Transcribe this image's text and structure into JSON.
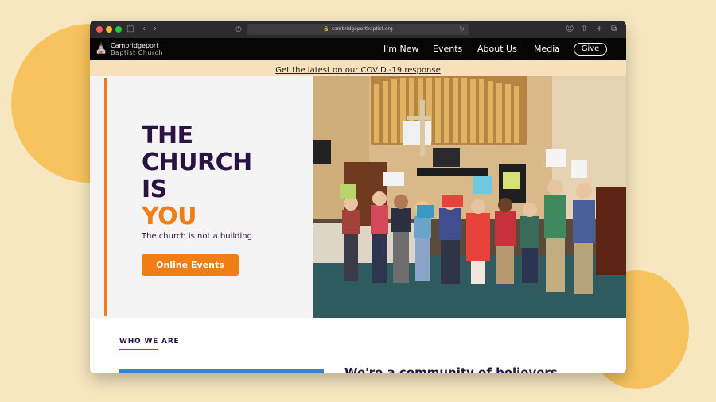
{
  "browser": {
    "url": "cambridgeportbaptist.org",
    "traffic_lights": [
      "#ff5f57",
      "#febc2e",
      "#28c840"
    ]
  },
  "site": {
    "logo_line1": "Cambridgeport",
    "logo_line2": "Baptist Church"
  },
  "nav": {
    "items": [
      {
        "label": "I'm New"
      },
      {
        "label": "Events"
      },
      {
        "label": "About Us"
      },
      {
        "label": "Media"
      }
    ],
    "give_label": "Give"
  },
  "banner": {
    "text": "Get the latest on our COVID -19 response"
  },
  "hero": {
    "line1": "THE",
    "line2": "CHURCH",
    "line3": "IS",
    "line4": "YOU",
    "tagline": "The church is not a building",
    "cta_label": "Online Events"
  },
  "who_we_are": {
    "label": "WHO WE ARE",
    "heading": "We're a community of believers"
  },
  "colors": {
    "accent": "#f07e17",
    "headline": "#2a1342",
    "banner_bg": "#f9e0bd",
    "page_bg": "#f7e7c0",
    "blob": "#f7c35e"
  }
}
